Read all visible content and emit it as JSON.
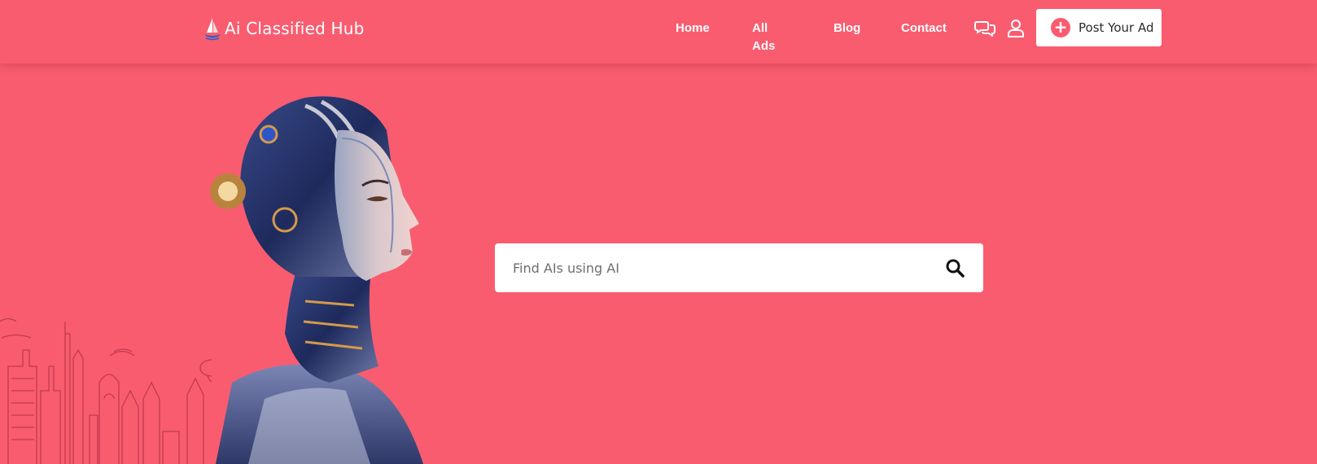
{
  "theme": {
    "primary": "#f95c6f",
    "white": "#ffffff",
    "text_dark": "#2b2b2b"
  },
  "header": {
    "logo_text": "Ai Classified Hub",
    "nav": [
      {
        "label": "Home"
      },
      {
        "label": "All Ads"
      },
      {
        "label": "Blog"
      },
      {
        "label": "Contact"
      }
    ],
    "icons": {
      "chat": "chat-bubbles-icon",
      "user": "user-icon"
    },
    "post_button": {
      "label": "Post Your Ad",
      "icon": "plus-circle-icon"
    }
  },
  "hero": {
    "search": {
      "placeholder": "Find AIs using AI",
      "value": "",
      "icon": "search-icon"
    }
  }
}
